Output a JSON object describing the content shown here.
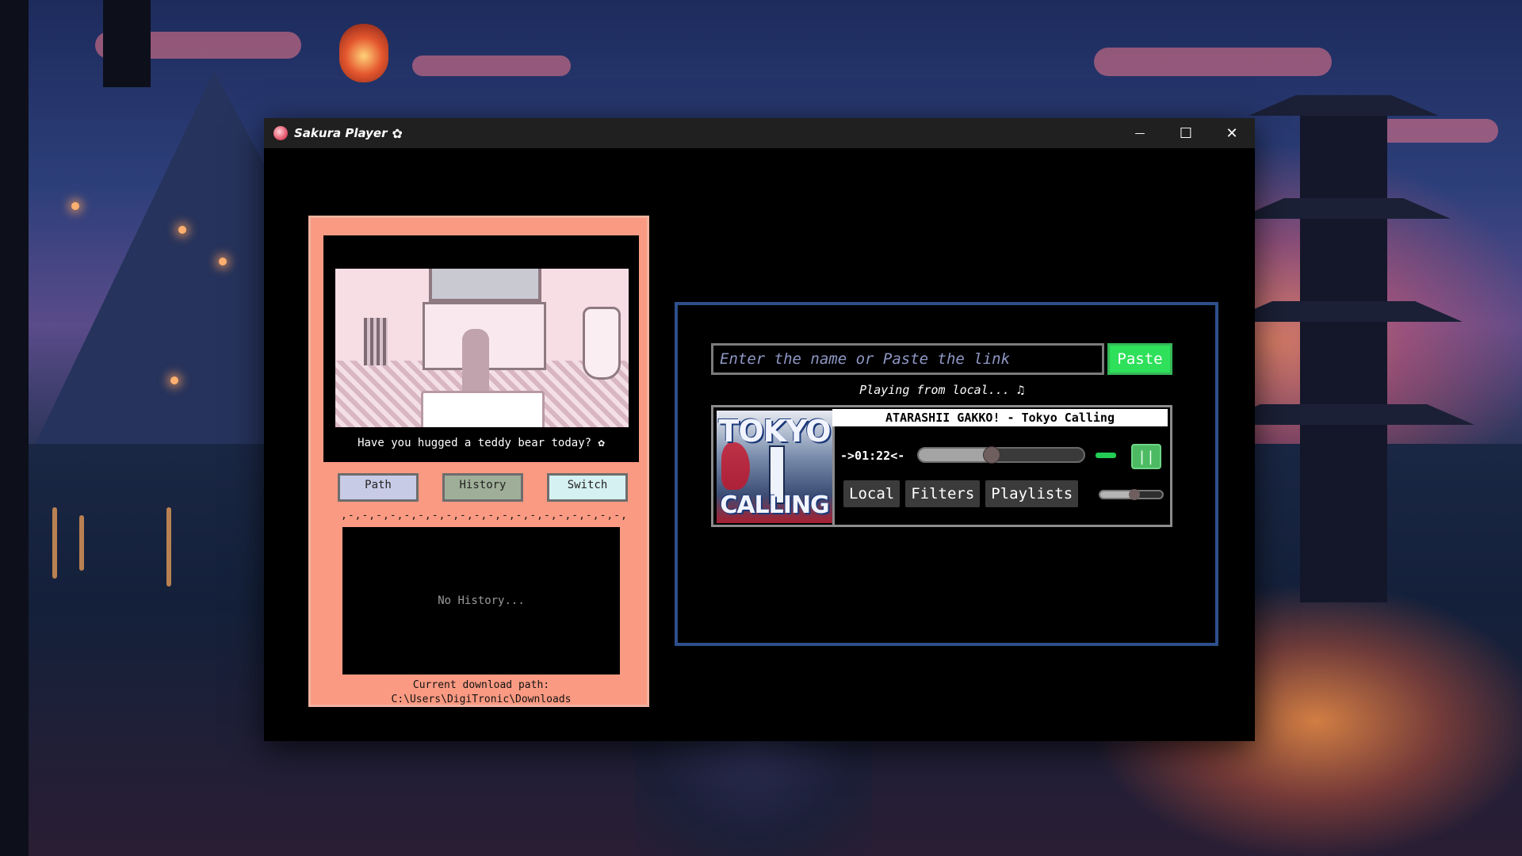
{
  "window": {
    "title": "Sakura Player",
    "title_icon": "sakura-app-icon",
    "title_flower": "✿",
    "controls": {
      "minimize": "—",
      "maximize": "☐",
      "close": "✕"
    }
  },
  "left_panel": {
    "gif_caption": "Have you hugged a teddy bear today? ✿",
    "buttons": {
      "path": "Path",
      "history": "History",
      "switch": "Switch"
    },
    "separator": ",-,-,-,-,-,-,-,-,-,-,-,-,-,-,-,-,-,-,-,-,-,-,-,-,-,-,-,",
    "history_empty": "No History...",
    "download_path": "Current download path: C:\\Users\\DigiTronic\\Downloads"
  },
  "player": {
    "search_placeholder": "Enter the name or Paste the link",
    "paste_label": "Paste",
    "status": "Playing from local... ♫",
    "track_title": "ATARASHII GAKKO! - Tokyo Calling",
    "cover_text": {
      "line1": "TOKYO",
      "line2": "CALLING"
    },
    "time": "->01:22<-",
    "progress_fraction": 0.44,
    "pause_label": "||",
    "tabs": [
      "Local",
      "Filters",
      "Playlists"
    ],
    "volume_fraction": 0.55
  },
  "colors": {
    "left_panel_bg": "#fa9a82",
    "accent_green": "#2ee05a",
    "panel_border_blue": "#2d4f8c"
  }
}
